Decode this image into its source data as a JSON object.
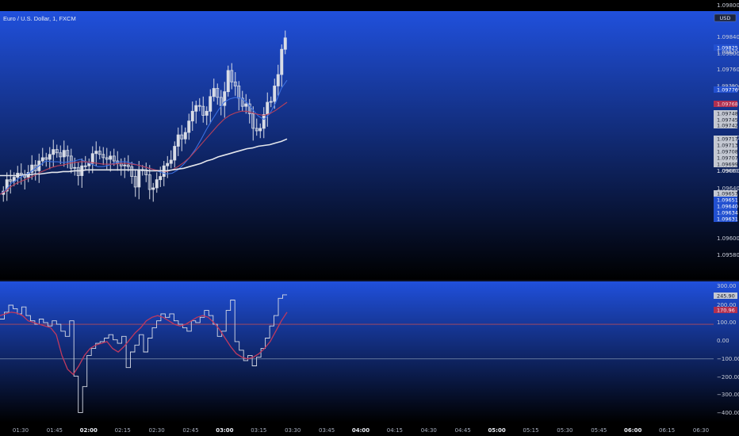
{
  "symbol_title": "Euro / U.S. Dollar, 1, FXCM",
  "currency_label": "USD",
  "colors": {
    "panel_top": "#2050dc",
    "panel_bottom": "#000000",
    "candles": "#d8dce6",
    "ma_fast": "#3b6fe0",
    "ma_mid": "#b8405a",
    "ma_slow": "#e4e6ec",
    "cci": "#d7dbe6",
    "cci_signal": "#c0395e",
    "band_line": "#b34a5a",
    "zero_line": "#8090b0",
    "price_tag_red": "#b03050",
    "price_tag_blue": "#2250d0",
    "price_tag_grey": "#c4c8d2",
    "price_tag_dark": "#2a2f3c"
  },
  "chart_data": [
    {
      "type": "candlestick",
      "title": "Euro / U.S. Dollar, 1, FXCM",
      "y_axis_labels": [
        "1.09800",
        "1.09840",
        "1.09800",
        "1.09760",
        "1.09720",
        "1.09680",
        "1.09660",
        "1.09640",
        "1.09600",
        "1.09580"
      ],
      "ylim": [
        1.0956,
        1.0988
      ],
      "price_tags": [
        {
          "label": "1.09825",
          "color": "blue"
        },
        {
          "label": "1.09820",
          "color": "none"
        },
        {
          "label": "1.09780",
          "color": "none"
        },
        {
          "label": "1.09776",
          "color": "blue"
        },
        {
          "label": "1.09768",
          "color": "red"
        },
        {
          "label": "1.09748",
          "color": "grey"
        },
        {
          "label": "1.09745",
          "color": "grey"
        },
        {
          "label": "1.09742",
          "color": "grey"
        },
        {
          "label": "1.09717",
          "color": "grey"
        },
        {
          "label": "1.09713",
          "color": "grey"
        },
        {
          "label": "1.09708",
          "color": "grey"
        },
        {
          "label": "1.09707",
          "color": "grey"
        },
        {
          "label": "1.09699",
          "color": "grey"
        },
        {
          "label": "1.09680",
          "color": "none"
        },
        {
          "label": "1.09657",
          "color": "grey"
        },
        {
          "label": "1.09651",
          "color": "blue"
        },
        {
          "label": "1.09640",
          "color": "blue"
        },
        {
          "label": "1.09634",
          "color": "blue"
        },
        {
          "label": "1.09631",
          "color": "blue"
        }
      ],
      "close_path": [
        1.09664,
        1.09678,
        1.09676,
        1.09681,
        1.09686,
        1.09684,
        1.09681,
        1.09687,
        1.09696,
        1.09689,
        1.09701,
        1.09705,
        1.09703,
        1.09709,
        1.09715,
        1.09711,
        1.09706,
        1.09714,
        1.09707,
        1.09692,
        1.09693,
        1.09683,
        1.09695,
        1.09695,
        1.09698,
        1.0971,
        1.09713,
        1.09709,
        1.09705,
        1.09703,
        1.09707,
        1.09701,
        1.09698,
        1.09695,
        1.09696,
        1.09694,
        1.09682,
        1.09669,
        1.09689,
        1.0969,
        1.09684,
        1.09666,
        1.09668,
        1.09678,
        1.09682,
        1.09695,
        1.09698,
        1.09702,
        1.09719,
        1.09733,
        1.09728,
        1.09736,
        1.0975,
        1.09762,
        1.09769,
        1.09768,
        1.09757,
        1.09762,
        1.0978,
        1.0979,
        1.09779,
        1.09769,
        1.09786,
        1.09812,
        1.09798,
        1.09793,
        1.09778,
        1.09768,
        1.09771,
        1.09759,
        1.09741,
        1.09738,
        1.09741,
        1.09758,
        1.09773,
        1.09774,
        1.09793,
        1.09807,
        1.09838,
        1.09852
      ],
      "moving_averages": [
        {
          "name": "fast",
          "values": [
            1.0966,
            1.09665,
            1.09674,
            1.09678,
            1.09683,
            1.09686,
            1.09691,
            1.09696,
            1.09701,
            1.097,
            1.097,
            1.09699,
            1.097,
            1.09701,
            1.09703,
            1.097,
            1.09697,
            1.09694,
            1.09694,
            1.09696,
            1.09699,
            1.097,
            1.097,
            1.09698,
            1.09696,
            1.09694,
            1.09692,
            1.0969,
            1.09687,
            1.09685,
            1.09686,
            1.0969,
            1.09697,
            1.09705,
            1.09715,
            1.09727,
            1.0974,
            1.09752,
            1.09763,
            1.09773,
            1.09777,
            1.09779,
            1.09778,
            1.09773,
            1.09764,
            1.09756,
            1.09752,
            1.09759,
            1.09772,
            1.0979,
            1.098
          ]
        },
        {
          "name": "mid",
          "values": [
            1.0966,
            1.09664,
            1.0967,
            1.09674,
            1.09677,
            1.0968,
            1.09683,
            1.09687,
            1.0969,
            1.09693,
            1.09695,
            1.09696,
            1.09698,
            1.09699,
            1.097,
            1.097,
            1.09699,
            1.09698,
            1.09697,
            1.09697,
            1.09697,
            1.09698,
            1.09698,
            1.09697,
            1.09696,
            1.09694,
            1.09692,
            1.0969,
            1.09689,
            1.09688,
            1.0969,
            1.09694,
            1.09699,
            1.09705,
            1.09713,
            1.09721,
            1.09729,
            1.09737,
            1.09745,
            1.09752,
            1.09757,
            1.0976,
            1.09762,
            1.09762,
            1.0976,
            1.09758,
            1.09757,
            1.09759,
            1.09763,
            1.09768,
            1.09773
          ]
        },
        {
          "name": "slow",
          "values": [
            1.09683,
            1.09683,
            1.09683,
            1.09683,
            1.09684,
            1.09684,
            1.09685,
            1.09685,
            1.09686,
            1.09687,
            1.09687,
            1.09688,
            1.09688,
            1.09689,
            1.09689,
            1.0969,
            1.0969,
            1.0969,
            1.0969,
            1.0969,
            1.0969,
            1.0969,
            1.0969,
            1.0969,
            1.0969,
            1.0969,
            1.09689,
            1.09689,
            1.09689,
            1.09689,
            1.0969,
            1.09691,
            1.09692,
            1.09694,
            1.09696,
            1.09698,
            1.09701,
            1.09703,
            1.09706,
            1.09708,
            1.0971,
            1.09712,
            1.09714,
            1.09716,
            1.09717,
            1.09719,
            1.0972,
            1.09721,
            1.09723,
            1.09725,
            1.09728
          ]
        }
      ]
    },
    {
      "type": "line",
      "y_axis_labels": [
        "300.00",
        "200.00",
        "100.00",
        "0.00",
        "−100.00",
        "−200.00",
        "−300.00",
        "−400.00"
      ],
      "ylim": [
        -440,
        320
      ],
      "bands": [
        100,
        -100
      ],
      "value_tags": [
        {
          "label": "245.90",
          "color": "grey"
        },
        {
          "label": "170.96",
          "color": "red"
        }
      ],
      "series": [
        {
          "values": [
            130,
            170,
            210,
            190,
            160,
            200,
            150,
            120,
            100,
            130,
            110,
            90,
            120,
            100,
            60,
            30,
            120,
            -200,
            -410,
            -260,
            -80,
            -40,
            -10,
            0,
            20,
            40,
            10,
            -10,
            30,
            -150,
            -60,
            -20,
            40,
            -60,
            20,
            80,
            120,
            160,
            140,
            160,
            120,
            100,
            80,
            60,
            120,
            110,
            140,
            180,
            150,
            100,
            30,
            60,
            180,
            240,
            0,
            -50,
            -110,
            -80,
            -140,
            -90,
            -40,
            20,
            90,
            150,
            250,
            270
          ]
        },
        {
          "values": [
            150,
            160,
            170,
            165,
            150,
            120,
            110,
            100,
            90,
            80,
            40,
            -80,
            -160,
            -190,
            -140,
            -80,
            -40,
            -20,
            -10,
            0,
            -40,
            -60,
            -30,
            10,
            50,
            80,
            120,
            140,
            150,
            140,
            120,
            100,
            90,
            100,
            120,
            140,
            150,
            140,
            110,
            70,
            20,
            -30,
            -70,
            -90,
            -100,
            -90,
            -70,
            -40,
            0,
            60,
            120,
            170
          ]
        }
      ]
    }
  ],
  "time_axis": [
    {
      "label": "01:30",
      "bold": false
    },
    {
      "label": "01:45",
      "bold": false
    },
    {
      "label": "02:00",
      "bold": true
    },
    {
      "label": "02:15",
      "bold": false
    },
    {
      "label": "02:30",
      "bold": false
    },
    {
      "label": "02:45",
      "bold": false
    },
    {
      "label": "03:00",
      "bold": true
    },
    {
      "label": "03:15",
      "bold": false
    },
    {
      "label": "03:30",
      "bold": false
    },
    {
      "label": "03:45",
      "bold": false
    },
    {
      "label": "04:00",
      "bold": true
    },
    {
      "label": "04:15",
      "bold": false
    },
    {
      "label": "04:30",
      "bold": false
    },
    {
      "label": "04:45",
      "bold": false
    },
    {
      "label": "05:00",
      "bold": true
    },
    {
      "label": "05:15",
      "bold": false
    },
    {
      "label": "05:30",
      "bold": false
    },
    {
      "label": "05:45",
      "bold": false
    },
    {
      "label": "06:00",
      "bold": true
    },
    {
      "label": "06:15",
      "bold": false
    },
    {
      "label": "06:30",
      "bold": false
    }
  ]
}
